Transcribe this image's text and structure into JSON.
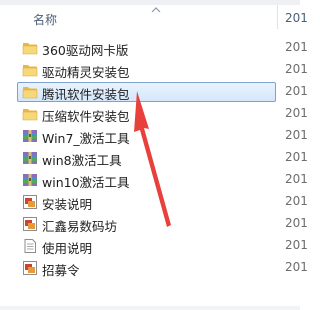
{
  "header": {
    "name_label": "名称",
    "date_label": "201"
  },
  "files": [
    {
      "name": "360驱动网卡版",
      "type": "folder",
      "date": "201"
    },
    {
      "name": "驱动精灵安装包",
      "type": "folder",
      "date": "201"
    },
    {
      "name": "腾讯软件安装包",
      "type": "folder",
      "date": "201",
      "selected": true
    },
    {
      "name": "压缩软件安装包",
      "type": "folder",
      "date": "201"
    },
    {
      "name": "Win7_激活工具",
      "type": "archive",
      "date": "201"
    },
    {
      "name": "win8激活工具",
      "type": "archive",
      "date": "201"
    },
    {
      "name": "win10激活工具",
      "type": "archive",
      "date": "201"
    },
    {
      "name": "安装说明",
      "type": "doc-image",
      "date": "201"
    },
    {
      "name": "汇鑫易数码坊",
      "type": "doc-image",
      "date": "201"
    },
    {
      "name": "使用说明",
      "type": "text",
      "date": "201"
    },
    {
      "name": "招募令",
      "type": "doc-image",
      "date": "201"
    }
  ],
  "colors": {
    "selection_border": "#7da2ce",
    "arrow": "#e8413c",
    "folder": "#f0c75a"
  }
}
